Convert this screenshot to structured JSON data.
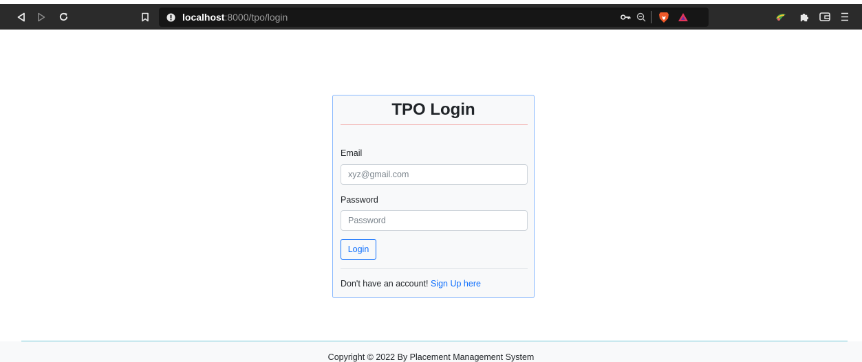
{
  "browser": {
    "url_host": "localhost",
    "url_path": ":8000/tpo/login",
    "icons": {
      "back": "back-icon",
      "forward": "forward-icon",
      "reload": "reload-icon",
      "bookmark": "bookmark-icon",
      "site_info": "info-icon",
      "password_key": "key-icon",
      "zoom": "zoom-out-icon",
      "brave_shields": "brave-lion-icon",
      "brave_rewards": "rewards-triangle-icon",
      "extension": "extension-colorful-icon",
      "extensions": "puzzle-icon",
      "wallet": "wallet-icon",
      "menu": "hamburger-menu-icon"
    },
    "colors": {
      "toolbar": "#2b2b2b",
      "urlbar": "#161616"
    }
  },
  "login": {
    "title": "TPO Login",
    "email_label": "Email",
    "email_placeholder": "xyz@gmail.com",
    "password_label": "Password",
    "password_placeholder": "Password",
    "login_button": "Login",
    "signup_prompt": "Don't have an account!",
    "signup_link": "Sign Up here",
    "colors": {
      "accent": "#0d6efd",
      "title_rule": "#f3b8b6",
      "card_border": "#86b7fe"
    }
  },
  "footer": {
    "text": "Copyright © 2022 By Placement Management System"
  }
}
